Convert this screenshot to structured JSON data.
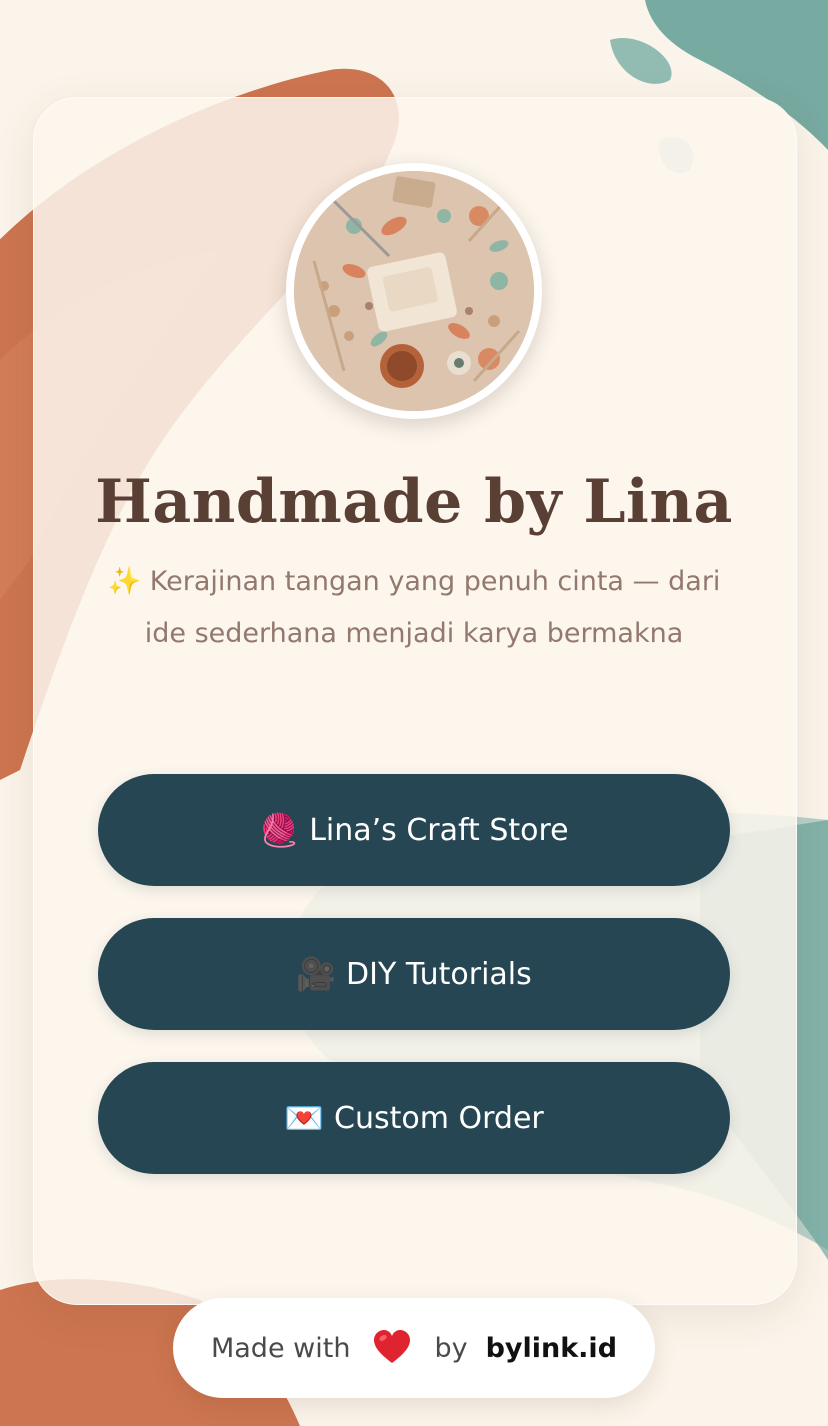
{
  "profile": {
    "title": "Handmade by Lina",
    "bio": "✨ Kerajinan tangan yang penuh cinta — dari ide sederhana menjadi karya bermakna"
  },
  "links": [
    {
      "emoji": "🧶",
      "label": "Lina’s Craft Store"
    },
    {
      "emoji": "🎥",
      "label": "DIY Tutorials"
    },
    {
      "emoji": "💌",
      "label": "Custom Order"
    }
  ],
  "footer": {
    "made_with": "Made with",
    "by": "by",
    "brand": "bylink.id"
  },
  "theme": {
    "background": "#fbf4ea",
    "button": "#264653",
    "title": "#5a3f35",
    "terracotta": "#c8673f",
    "teal": "#6fa89f"
  }
}
